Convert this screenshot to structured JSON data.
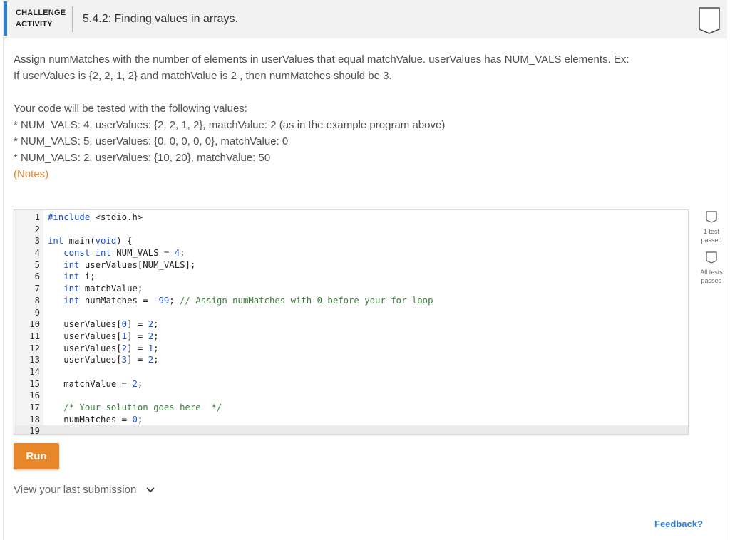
{
  "header": {
    "badge_line1": "CHALLENGE",
    "badge_line2": "ACTIVITY",
    "title": "5.4.2: Finding values in arrays."
  },
  "instructions": {
    "p1_line1": "Assign numMatches with the number of elements in userValues that equal matchValue. userValues has NUM_VALS elements. Ex:",
    "p1_line2": "If userValues is {2, 2, 1, 2} and matchValue is 2 , then numMatches should be 3.",
    "p2_intro": "Your code will be tested with the following values:",
    "tests": [
      "* NUM_VALS: 4, userValues: {2, 2, 1, 2}, matchValue: 2 (as in the example program above)",
      "* NUM_VALS: 5, userValues: {0, 0, 0, 0, 0}, matchValue: 0",
      "* NUM_VALS: 2, userValues: {10, 20}, matchValue: 50"
    ],
    "notes_link": "(Notes)"
  },
  "editor": {
    "line_numbers": [
      "1",
      "2",
      "3",
      "4",
      "5",
      "6",
      "7",
      "8",
      "9",
      "10",
      "11",
      "12",
      "13",
      "14",
      "15",
      "16",
      "17",
      "18",
      "19"
    ],
    "code": {
      "l1_kw": "#include",
      "l1_rest": " <stdio.h>",
      "l3_kw1": "int",
      "l3_mid": " main(",
      "l3_kw2": "void",
      "l3_end": ") {",
      "l4_kw": "const int",
      "l4_mid": " NUM_VALS = ",
      "l4_num": "4",
      "l4_end": ";",
      "l5_kw": "int",
      "l5_rest": " userValues[NUM_VALS];",
      "l6_kw": "int",
      "l6_rest": " i;",
      "l7_kw": "int",
      "l7_rest": " matchValue;",
      "l8_kw": "int",
      "l8_mid": " numMatches = ",
      "l8_num": "-99",
      "l8_semi": "; ",
      "l8_cmt": "// Assign numMatches with 0 before your for loop",
      "l10_a": "userValues[",
      "l10_i": "0",
      "l10_b": "] = ",
      "l10_v": "2",
      "l11_a": "userValues[",
      "l11_i": "1",
      "l11_b": "] = ",
      "l11_v": "2",
      "l12_a": "userValues[",
      "l12_i": "2",
      "l12_b": "] = ",
      "l12_v": "1",
      "l13_a": "userValues[",
      "l13_i": "3",
      "l13_b": "] = ",
      "l13_v": "2",
      "l15_a": "matchValue = ",
      "l15_v": "2",
      "l17_cmt": "/* Your solution goes here  */",
      "l18_a": "numMatches = ",
      "l18_v": "0",
      "semi": ";"
    }
  },
  "status": {
    "test1_line1": "1 test",
    "test1_line2": "passed",
    "test2_line1": "All tests",
    "test2_line2": "passed"
  },
  "run_label": "Run",
  "last_submission_label": "View your last submission",
  "feedback_label": "Feedback?",
  "colors": {
    "accent_blue": "#2f7fd1",
    "run_orange": "#e8862a",
    "keyword_blue": "#1b4fd6",
    "comment_green": "#3b7f3b"
  }
}
